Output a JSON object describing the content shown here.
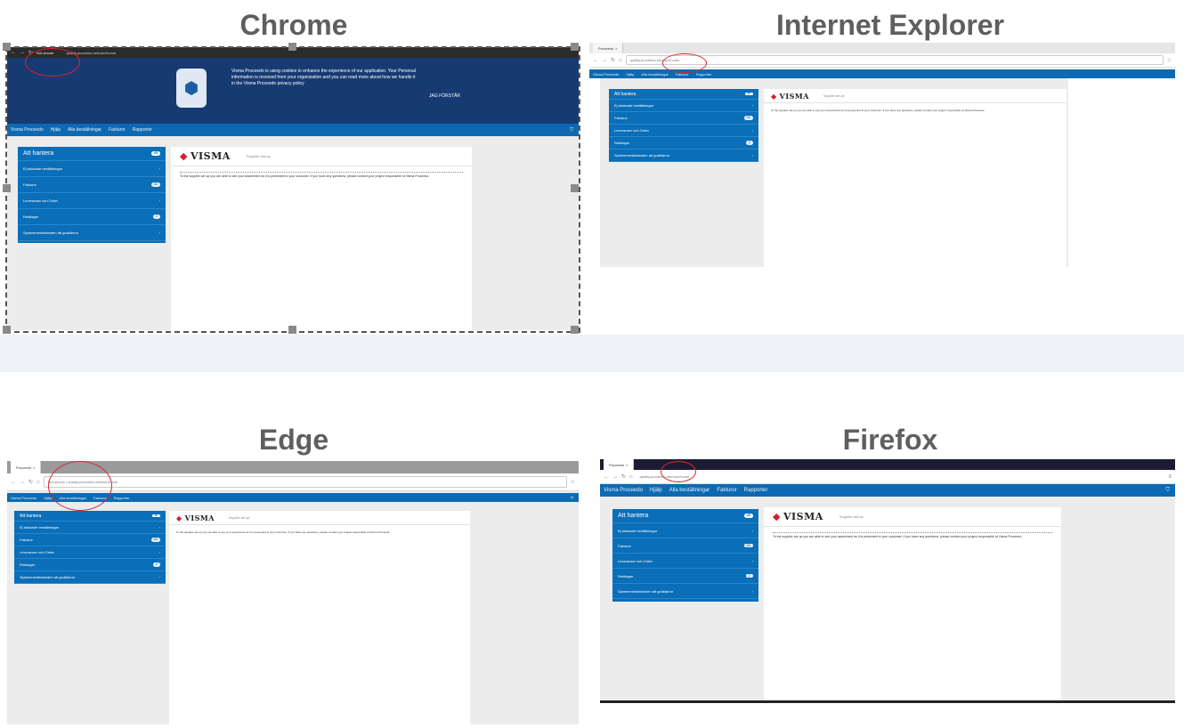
{
  "titles": {
    "chrome": "Chrome",
    "ie": "Internet Explorer",
    "edge": "Edge",
    "firefox": "Firefox"
  },
  "browser": {
    "tab_label": "Proceedo",
    "not_secure": "Not secure",
    "url": "quality.proceedo.net/user/home"
  },
  "cookie_banner": {
    "text": "Visma Proceedo is using cookies to enhance the experience of our application. Your Personal information is received from your organization and you can read more about how we handle it in the Visma Proceedo privacy policy",
    "button": "JAG FÖRSTÅR"
  },
  "app_nav": {
    "items": [
      "Visma Proceedo",
      "Hjälp",
      "Alla beställningar",
      "Fakturor",
      "Rapporter"
    ],
    "cart_icon": "cart-icon",
    "user_icon": "user-icon"
  },
  "sidebar": {
    "title": "Att hantera",
    "title_badge": "45",
    "items": [
      {
        "label": "Ej skickade beställningar",
        "badge": ""
      },
      {
        "label": "Fakturor",
        "badge": "86"
      },
      {
        "label": "Leveranser och Order",
        "badge": ""
      },
      {
        "label": "Rekttager",
        "badge": "2"
      },
      {
        "label": "Systemmeddelanden att godkänna",
        "badge": ""
      }
    ]
  },
  "content": {
    "logo_text": "VISMA",
    "setup_label": "Supplier set-up",
    "message": "To the supplier set-up you are able to see your assortment as it is presented to your customer. If you have any questions, please contact your project responsible at Visma Proceedo."
  },
  "colors": {
    "accent": "#0a6eb8",
    "banner": "#173a72",
    "title_gray": "#5f5f5f",
    "annotation_red": "#d8262e"
  }
}
